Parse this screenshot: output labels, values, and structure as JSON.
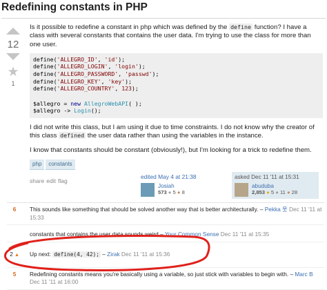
{
  "question": {
    "title": "Redefining constants in PHP",
    "votes": "12",
    "favorites": "1",
    "intro_before": "Is it possible to redefine a constant in php which was defined by the ",
    "intro_code": "define",
    "intro_after": " function? I have a class with several constants that contains the user data. I'm trying to use the class for more than one user.",
    "code_lines": [
      {
        "pre": "define(",
        "str": "'ALLEGRO_ID'",
        "mid": ", ",
        "str2": "'id'",
        "post": ");"
      },
      {
        "pre": "define(",
        "str": "'ALLEGRO_LOGIN'",
        "mid": ", ",
        "str2": "'login'",
        "post": ");"
      },
      {
        "pre": "define(",
        "str": "'ALLEGRO_PASSWORD'",
        "mid": ", ",
        "str2": "'passwd'",
        "post": ");"
      },
      {
        "pre": "define(",
        "str": "'ALLEGRO_KEY'",
        "mid": ", ",
        "str2": "'key'",
        "post": ");"
      },
      {
        "pre": "define(",
        "str": "'ALLEGRO_COUNTRY'",
        "mid": ", ",
        "str2": "123",
        "post": ");"
      }
    ],
    "code_line6": {
      "a": "$allegro = ",
      "kw": "new",
      "b": " ",
      "typ": "AllegroWebAPI",
      "c": "( );"
    },
    "code_line7": {
      "a": "$allegro -> ",
      "typ": "Login",
      "c": "();"
    },
    "para2_before": "I did not write this class, but I am using it due to time constraints. I do not know why the creator of this class ",
    "para2_code": "defined",
    "para2_after": " the user data rather than using the variables in the instance.",
    "para3": "I know that constants should be constant (obviously!), but I'm looking for a trick to redefine them.",
    "tags": [
      "php",
      "constants"
    ],
    "menu": [
      "share",
      "edit",
      "flag"
    ]
  },
  "editor": {
    "action": "edited May 4 at 21:38",
    "name": "Josiah",
    "rep": "573",
    "badge_silver": "5",
    "badge_bronze": "8"
  },
  "asker": {
    "action": "asked Dec 11 '11 at 15:31",
    "name": "abuduba",
    "rep": "2,853",
    "badge_gold": "5",
    "badge_silver": "11",
    "badge_bronze": "28"
  },
  "comments": [
    {
      "score": "6",
      "text": "This sounds like something that should be solved another way that is better architecturally.",
      "sep": " – ",
      "user": "Pekka 웃",
      "date": " Dec 11 '11 at 15:33"
    },
    {
      "score": "",
      "text": "constants that contains the user data sounds weird",
      "sep": " – ",
      "user": "Your Common Sense",
      "date": " Dec 11 '11 at 15:35"
    },
    {
      "score": "2",
      "text_before": "Up next: ",
      "code": "define(4, 42);",
      "sep": " – ",
      "user": "Zirak",
      "date": " Dec 11 '11 at 15:36"
    },
    {
      "score": "5",
      "text": "Redefining constants means you're basically using a variable, so just stick with variables to begin with.",
      "sep": " – ",
      "user": "Marc B",
      "date": " Dec 11 '11 at 16:00"
    }
  ],
  "colors": {
    "link": "#3a6fb0",
    "tag_bg": "#e0eaf1",
    "annotation": "#e0201a"
  }
}
